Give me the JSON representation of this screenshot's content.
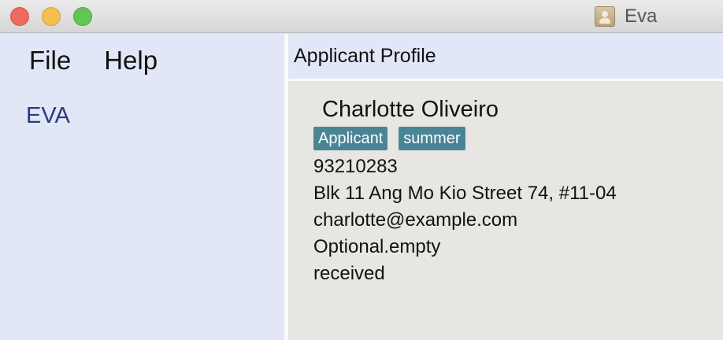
{
  "window": {
    "title": "Eva"
  },
  "menu": {
    "items": [
      {
        "label": "File"
      },
      {
        "label": "Help"
      }
    ]
  },
  "sidebar": {
    "brand": "EVA"
  },
  "panel": {
    "title": "Applicant Profile"
  },
  "profile": {
    "name": "Charlotte Oliveiro",
    "tags": [
      "Applicant",
      "summer"
    ],
    "phone": "93210283",
    "address": "Blk 11 Ang Mo Kio Street 74, #11-04",
    "email": "charlotte@example.com",
    "extra": "Optional.empty",
    "status": "received"
  },
  "colors": {
    "sidebar_bg": "#e1e7f7",
    "tag_bg": "#4a8596",
    "brand_text": "#2c3a80"
  }
}
